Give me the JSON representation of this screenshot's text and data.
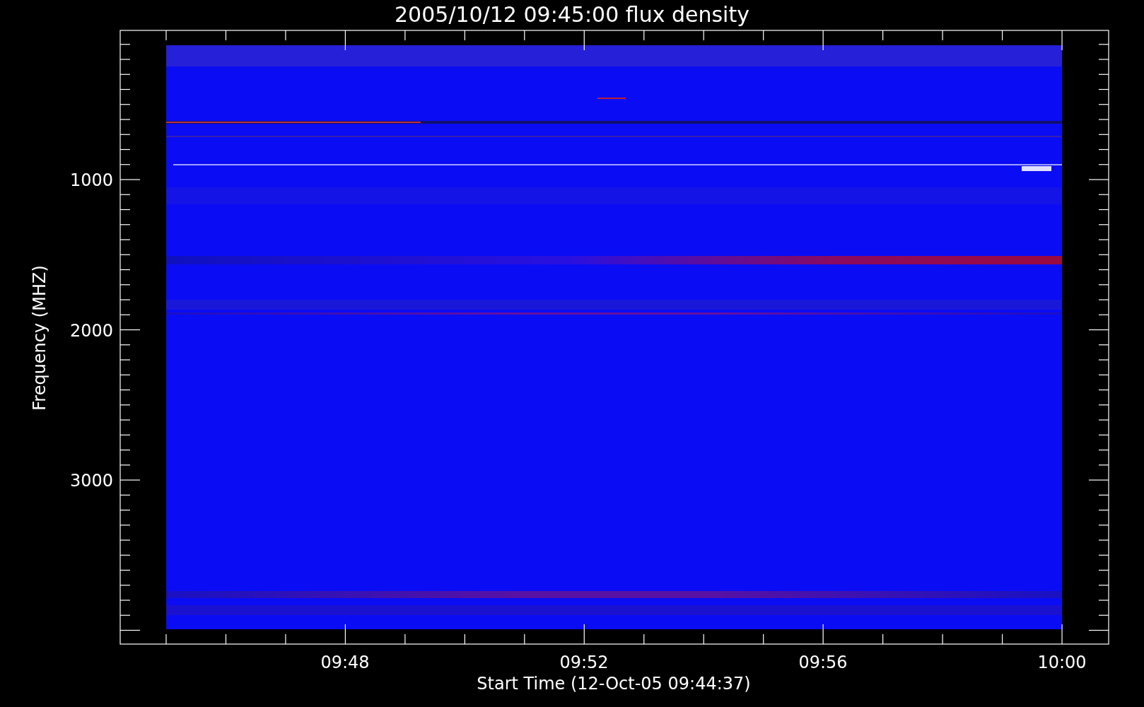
{
  "plot": {
    "title": "2005/10/12 09:45:00 flux density",
    "y_axis": {
      "label": "Frequency (MHZ)",
      "ticks": [
        "1000",
        "2000",
        "3000"
      ]
    },
    "x_axis": {
      "label": "Start Time (12-Oct-05 09:44:37)",
      "ticks": [
        "09:48",
        "09:52",
        "09:56",
        "10:00"
      ]
    }
  }
}
